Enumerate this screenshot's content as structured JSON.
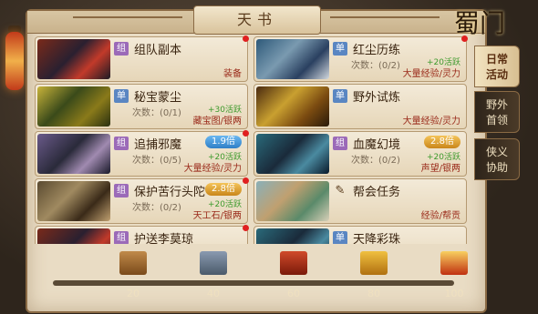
{
  "title": "天书",
  "logo": "蜀门",
  "tabs": [
    {
      "label": "日常\n活动",
      "active": true
    },
    {
      "label": "野外\n首领",
      "active": false
    },
    {
      "label": "侠义\n协助",
      "active": false
    }
  ],
  "cards": [
    {
      "tag": "组",
      "tag_type": "zu",
      "name": "组队副本",
      "count": "",
      "active": "",
      "reward": "装备",
      "mult": "",
      "dot": true
    },
    {
      "tag": "单",
      "tag_type": "dan",
      "name": "红尘历练",
      "count": "次数：(0/2)",
      "active": "+20活跃",
      "reward": "大量经验/灵力",
      "mult": "",
      "dot": true
    },
    {
      "tag": "单",
      "tag_type": "dan",
      "name": "秘宝蒙尘",
      "count": "次数：(0/1)",
      "active": "+30活跃",
      "reward": "藏宝图/银两",
      "mult": "",
      "dot": false
    },
    {
      "tag": "单",
      "tag_type": "dan",
      "name": "野外试炼",
      "count": "",
      "active": "",
      "reward": "大量经验/灵力",
      "mult": "",
      "dot": false
    },
    {
      "tag": "组",
      "tag_type": "zu",
      "name": "追捕邪魔",
      "count": "次数：(0/5)",
      "active": "+20活跃",
      "reward": "大量经验/灵力",
      "mult": "1.9倍",
      "mult_color": "blue",
      "dot": true
    },
    {
      "tag": "组",
      "tag_type": "zu",
      "name": "血魔幻境",
      "count": "次数：(0/2)",
      "active": "+20活跃",
      "reward": "声望/银两",
      "mult": "2.8倍",
      "mult_color": "gold",
      "dot": false
    },
    {
      "tag": "组",
      "tag_type": "zu",
      "name": "保护苦行头陀",
      "count": "次数：(0/2)",
      "active": "+20活跃",
      "reward": "天工石/银两",
      "mult": "2.8倍",
      "mult_color": "gold",
      "dot": true
    },
    {
      "tag": "✎",
      "tag_type": "task",
      "name": "帮会任务",
      "count": "",
      "active": "",
      "reward": "经验/帮贡",
      "mult": "",
      "dot": false
    },
    {
      "tag": "组",
      "tag_type": "zu",
      "name": "护送李莫琼",
      "count": "",
      "active": "",
      "reward": "",
      "mult": "",
      "dot": true
    },
    {
      "tag": "单",
      "tag_type": "dan",
      "name": "天降彩珠",
      "count": "",
      "active": "",
      "reward": "",
      "mult": "",
      "dot": false
    }
  ],
  "progress": {
    "value": 0,
    "max": 100,
    "milestones": [
      "20",
      "40",
      "60",
      "80",
      "100"
    ]
  }
}
